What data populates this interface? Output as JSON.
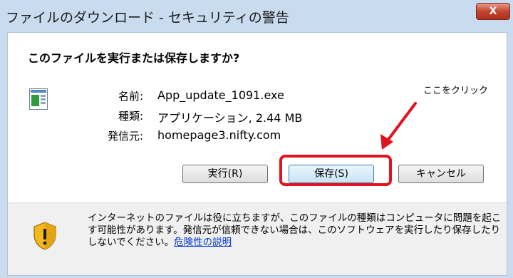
{
  "window": {
    "title": "ファイルのダウンロード - セキュリティの警告",
    "close_label": "X"
  },
  "dialog": {
    "question": "このファイルを実行または保存しますか?",
    "file_icon": "application-window-icon",
    "name_label": "名前:",
    "name_value": "App_update_1091.exe",
    "type_label": "種類:",
    "type_value": "アプリケーション, 2.44 MB",
    "from_label": "発信元:",
    "from_value": "homepage3.nifty.com"
  },
  "buttons": {
    "run": "実行(R)",
    "save": "保存(S)",
    "cancel": "キャンセル"
  },
  "warning": {
    "icon": "shield-warning-icon",
    "text": "インターネットのファイルは役に立ちますが、このファイルの種類はコンピュータに問題を起こす可能性があります。発信元が信頼できない場合は、このソフトウェアを実行したり保存したりしないでください。",
    "link": "危険性の説明"
  },
  "annotation": {
    "text": "ここをクリック",
    "color": "#e0141e"
  }
}
